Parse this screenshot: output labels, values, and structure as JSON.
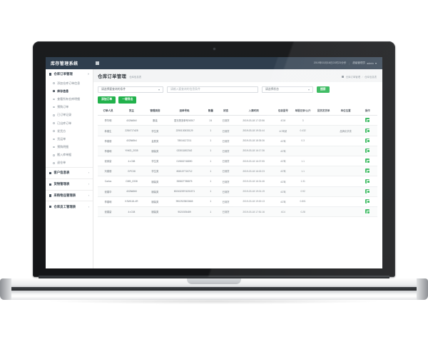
{
  "topbar": {
    "brand": "库存管理系统",
    "menu_toggle_icon": "hamburger-icon",
    "datetime": "2019年03月18日21时23分秒",
    "separator": "|",
    "user_label": "超级管理员",
    "user_name": "admin",
    "caret_icon": "chevron-down-icon"
  },
  "sidebar": {
    "group": {
      "label": "仓库订单管理",
      "icon": "box-icon",
      "arrow": "chevron-up-icon"
    },
    "items": [
      {
        "label": "添加仓库订单信息"
      },
      {
        "label": "库存信息",
        "active": true
      },
      {
        "label": "查看所有仓库明细"
      },
      {
        "label": "预购订单"
      },
      {
        "label": "已订单记录"
      },
      {
        "label": "已出库订单"
      },
      {
        "label": "发货方"
      },
      {
        "label": "货运单"
      },
      {
        "label": "预购明细"
      },
      {
        "label": "搬入库单据"
      },
      {
        "label": "退仓单"
      }
    ],
    "sections": [
      {
        "label": "客户信息表",
        "icon": "user-icon",
        "arrow": "chevron-right-icon"
      },
      {
        "label": "货物管理表",
        "icon": "gear-icon",
        "arrow": "chevron-right-icon"
      },
      {
        "label": "采购物品管理表",
        "icon": "cart-icon",
        "arrow": "chevron-right-icon"
      },
      {
        "label": "仓库员工管理表",
        "icon": "list-icon",
        "arrow": "chevron-right-icon"
      }
    ]
  },
  "page": {
    "title": "仓库订单管理",
    "subtitle": "仓库信息表",
    "breadcrumb": {
      "home_icon": "home-icon",
      "first": "仓库订单管理",
      "sep": "/",
      "last": "仓库信息表"
    }
  },
  "filters": {
    "select_category": "请选择要查询的条件",
    "search_placeholder": "请输入要查询的信息条件",
    "select_status": "请选择状态",
    "search_button": "搜索",
    "caret_icon": "chevron-down-icon"
  },
  "toolbar": {
    "add_button": "添加订单",
    "export_button": "一键导出"
  },
  "table": {
    "columns": [
      "订单人员",
      "货主",
      "管理类别",
      "运单号码",
      "数量",
      "状态",
      "入库时间",
      "包装型号",
      "单据记录/公斤",
      "回货发货单",
      "单位位置",
      "操作"
    ],
    "rows": [
      {
        "person": "李华明",
        "owner": "4028d8b0",
        "category": "服装",
        "waybill": "暂无物流单号08307",
        "qty": "24",
        "status": "已到货",
        "intime": "2019-03-18 17:22:56",
        "model": "4CM",
        "record": "3",
        "back": "",
        "unit": "",
        "op": "detail-button"
      },
      {
        "person": "林春生",
        "owner": "2284717d28",
        "category": "学生类",
        "waybill": "2290130033129",
        "qty": "1",
        "status": "已到货",
        "intime": "2019-03-18 19:31:44",
        "model": "4C驾驶",
        "record": "0.432",
        "back": "",
        "unit": "品牌化学类",
        "op": "detail-button"
      },
      {
        "person": "李春丽",
        "owner": "4028d8b4",
        "category": "金属类",
        "waybill": "78516127211",
        "qty": "1",
        "status": "已到货",
        "intime": "2019-03-18 18:35:36",
        "model": "4C驾",
        "record": "0.3",
        "back": "",
        "unit": "",
        "op": "detail-button"
      },
      {
        "person": "李春明",
        "owner": "YNKD_2035",
        "category": "服装类",
        "waybill": "023011802342",
        "qty": "1",
        "status": "已到货",
        "intime": "2019-03-18 16:17:36",
        "model": "4C驾",
        "record": "",
        "back": "",
        "unit": "",
        "op": "detail-button"
      },
      {
        "person": "张家豪",
        "owner": "4=C88",
        "category": "学生类",
        "waybill": "019802748890",
        "qty": "1",
        "status": "已到货",
        "intime": "2019-03-18 16:07:55",
        "model": "4C驾",
        "record": "1.1",
        "back": "",
        "unit": "",
        "op": "detail-button"
      },
      {
        "person": "刘春丽",
        "owner": "GPC38",
        "category": "学生类",
        "waybill": "808107710712",
        "qty": "1",
        "status": "已到货",
        "intime": "2019-03-18 16:02:23",
        "model": "4C驾",
        "record": "1.1",
        "back": "",
        "unit": "",
        "op": "detail-button"
      },
      {
        "person": "Carlos",
        "owner": "CMB_0338",
        "category": "服装类",
        "waybill": "355827788875",
        "qty": "1",
        "status": "已到货",
        "intime": "2019-03-18 16:31:46",
        "model": "4C驾",
        "record": "1.31",
        "back": "",
        "unit": "",
        "op": "detail-button"
      },
      {
        "person": "张春华",
        "owner": "4028d8b5",
        "category": "服装类",
        "waybill": "8024320974201571",
        "qty": "1",
        "status": "已到货",
        "intime": "2019-03-18 19:01:19",
        "model": "4C驾",
        "record": "0.92",
        "back": "",
        "unit": "",
        "op": "detail-button"
      },
      {
        "person": "李春明",
        "owner": "KSW118-4R",
        "category": "服装类",
        "waybill": "9902923503665",
        "qty": "1",
        "status": "已到货",
        "intime": "2019-03-18 19:00:13",
        "model": "4C驾",
        "record": "0.801",
        "back": "",
        "unit": "",
        "op": "detail-button"
      },
      {
        "person": "张春豪",
        "owner": "4=C08",
        "category": "服装类",
        "waybill": "9021925489",
        "qty": "1",
        "status": "已到货",
        "intime": "2019-03-18 17:51:16",
        "model": "4C4",
        "record": "0.28",
        "back": "",
        "unit": "",
        "op": "detail-button"
      }
    ]
  },
  "colors": {
    "header_bg": "#2f3e4e",
    "accent_green": "#22b24c",
    "page_bg": "#f3f4f5",
    "panel_bg": "#ffffff"
  }
}
